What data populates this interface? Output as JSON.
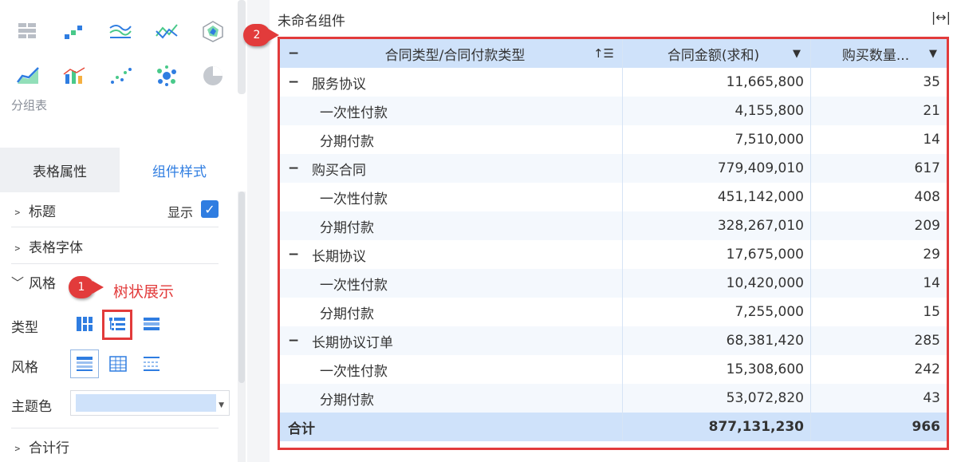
{
  "left_panel": {
    "group_label": "分组表",
    "tabs": {
      "table_props": "表格属性",
      "component_style": "组件样式"
    },
    "sections": {
      "title": "标题",
      "show_label": "显示",
      "table_font": "表格字体",
      "style": "风格",
      "total_row": "合计行"
    },
    "rows": {
      "type_label": "类型",
      "style_label": "风格",
      "theme_label": "主题色"
    },
    "theme_color": "#cfe2fa"
  },
  "callouts": {
    "one_number": "1",
    "one_text": "树状展示",
    "two_number": "2"
  },
  "component": {
    "title": "未命名组件",
    "columns": [
      "合同类型/合同付款类型",
      "合同金额(求和)",
      "购买数量..."
    ],
    "rows": [
      {
        "label": "服务协议",
        "amount": "11,665,800",
        "qty": "35",
        "level": 0
      },
      {
        "label": "一次性付款",
        "amount": "4,155,800",
        "qty": "21",
        "level": 1
      },
      {
        "label": "分期付款",
        "amount": "7,510,000",
        "qty": "14",
        "level": 1
      },
      {
        "label": "购买合同",
        "amount": "779,409,010",
        "qty": "617",
        "level": 0
      },
      {
        "label": "一次性付款",
        "amount": "451,142,000",
        "qty": "408",
        "level": 1
      },
      {
        "label": "分期付款",
        "amount": "328,267,010",
        "qty": "209",
        "level": 1
      },
      {
        "label": "长期协议",
        "amount": "17,675,000",
        "qty": "29",
        "level": 0
      },
      {
        "label": "一次性付款",
        "amount": "10,420,000",
        "qty": "14",
        "level": 1
      },
      {
        "label": "分期付款",
        "amount": "7,255,000",
        "qty": "15",
        "level": 1
      },
      {
        "label": "长期协议订单",
        "amount": "68,381,420",
        "qty": "285",
        "level": 0
      },
      {
        "label": "一次性付款",
        "amount": "15,308,600",
        "qty": "242",
        "level": 1
      },
      {
        "label": "分期付款",
        "amount": "53,072,820",
        "qty": "43",
        "level": 1
      }
    ],
    "total": {
      "label": "合计",
      "amount": "877,131,230",
      "qty": "966"
    }
  }
}
